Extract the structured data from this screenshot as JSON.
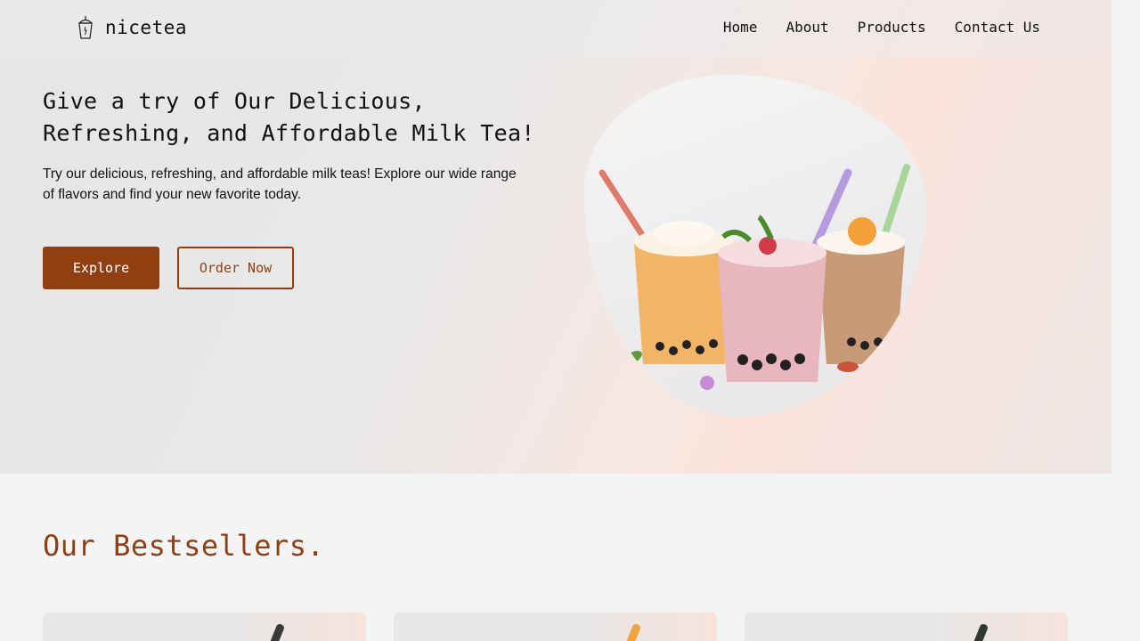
{
  "header": {
    "brand": "nicetea",
    "logo_icon": "bubble-tea-cup-icon",
    "nav": [
      {
        "label": "Home"
      },
      {
        "label": "About"
      },
      {
        "label": "Products"
      },
      {
        "label": "Contact Us"
      }
    ]
  },
  "hero": {
    "title": "Give a try of Our Delicious, Refreshing, and Affordable Milk Tea!",
    "description": "Try our delicious, refreshing, and affordable milk teas! Explore our wide range of flavors and find your new favorite today.",
    "explore_label": "Explore",
    "order_label": "Order Now",
    "image_subject": "three-milk-tea-glasses-image"
  },
  "bestsellers": {
    "title": "Our Bestsellers.",
    "cards": [
      {
        "straw_color": "#3a3a3a"
      },
      {
        "straw_color": "#f2a33a"
      },
      {
        "straw_color": "#2c3a33"
      }
    ]
  },
  "colors": {
    "accent": "#8f3f12",
    "page_bg": "#f3f4f6"
  }
}
